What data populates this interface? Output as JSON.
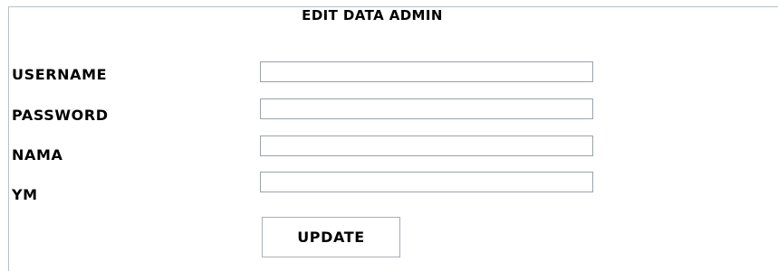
{
  "form": {
    "title": "EDIT DATA ADMIN",
    "fields": [
      {
        "label": "USERNAME",
        "value": "",
        "placeholder": ""
      },
      {
        "label": "PASSWORD",
        "value": "",
        "placeholder": ""
      },
      {
        "label": "NAMA",
        "value": "",
        "placeholder": ""
      },
      {
        "label": "YM",
        "value": "",
        "placeholder": ""
      }
    ],
    "submit_label": "UPDATE"
  },
  "colors": {
    "border": "#9aa3a9",
    "frame_border": "#b8c0c6",
    "text": "#000000",
    "background": "#ffffff"
  }
}
